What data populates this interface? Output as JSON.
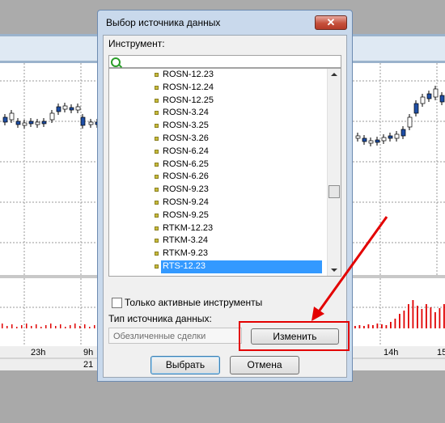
{
  "dialog": {
    "title": "Выбор источника данных",
    "close_symbol": "✕",
    "instrument_label": "Инструмент:",
    "search": {
      "value": "",
      "icon": "search-icon"
    },
    "instruments": [
      "ROSN-12.23",
      "ROSN-12.24",
      "ROSN-12.25",
      "ROSN-3.24",
      "ROSN-3.25",
      "ROSN-3.26",
      "ROSN-6.24",
      "ROSN-6.25",
      "ROSN-6.26",
      "ROSN-9.23",
      "ROSN-9.24",
      "ROSN-9.25",
      "RTKM-12.23",
      "RTKM-3.24",
      "RTKM-9.23",
      "RTS-12.23"
    ],
    "selected_instrument": "RTS-12.23",
    "active_only_label": "Только активные инструменты",
    "active_only_checked": false,
    "source_type_label": "Тип источника данных:",
    "source_type_value": "Обезличенные сделки",
    "change_button": "Изменить",
    "ok_button": "Выбрать",
    "cancel_button": "Отмена"
  },
  "background_chart": {
    "time_labels": [
      "23h",
      "9h",
      "14h",
      "15"
    ],
    "date_label": "21"
  },
  "colors": {
    "accent_red": "#e30000",
    "selection": "#3399ff"
  }
}
